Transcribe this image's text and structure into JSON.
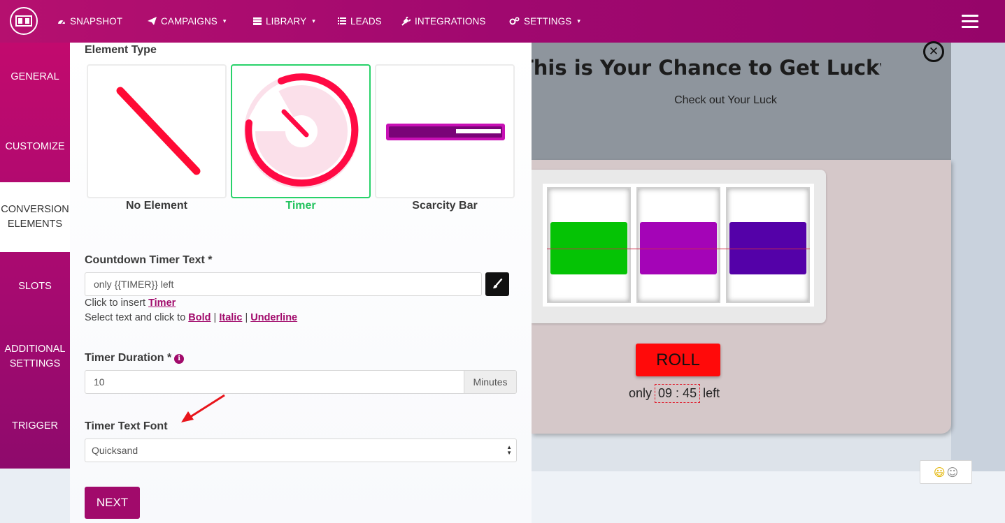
{
  "topnav": {
    "items": [
      {
        "icon": "dashboard-icon",
        "label": "SNAPSHOT",
        "caret": false
      },
      {
        "icon": "paper-plane-icon",
        "label": "CAMPAIGNS",
        "caret": true
      },
      {
        "icon": "library-icon",
        "label": "LIBRARY",
        "caret": true
      },
      {
        "icon": "list-icon",
        "label": "LEADS",
        "caret": false
      },
      {
        "icon": "plug-icon",
        "label": "INTEGRATIONS",
        "caret": false
      },
      {
        "icon": "gears-icon",
        "label": "SETTINGS",
        "caret": true
      }
    ],
    "caret": "▾"
  },
  "sidebar": {
    "items": [
      {
        "label": "GENERAL"
      },
      {
        "label": "CUSTOMIZE"
      },
      {
        "label": "CONVERSION ELEMENTS",
        "active": true
      },
      {
        "label": "SLOTS"
      },
      {
        "label": "ADDITIONAL SETTINGS"
      },
      {
        "label": "TRIGGER"
      }
    ]
  },
  "editor": {
    "element_type_label": "Element Type",
    "cards": [
      {
        "label": "No Element",
        "selected": false
      },
      {
        "label": "Timer",
        "selected": true
      },
      {
        "label": "Scarcity Bar",
        "selected": false
      }
    ],
    "countdown_label": "Countdown Timer Text *",
    "countdown_value": "only {{TIMER}} left",
    "insert_hint_prefix": "Click to insert ",
    "insert_hint_link": "Timer",
    "format_hint_prefix": "Select text and click to ",
    "format_bold": "Bold",
    "format_italic": "Italic",
    "format_underline": "Underline",
    "separator": "|",
    "duration_label": "Timer Duration *",
    "duration_value": "10",
    "duration_unit": "Minutes",
    "font_label": "Timer Text Font",
    "font_value": "Quicksand",
    "next_label": "NEXT"
  },
  "preview": {
    "headline": "This is Your Chance to Get Lucky!",
    "subline": "Check out Your Luck",
    "roll_label": "ROLL",
    "timer_prefix": "only",
    "timer_value": "09 : 45",
    "timer_suffix": "left",
    "reel_colors": [
      "#05c305",
      "#a404b7",
      "#5401a8"
    ]
  },
  "colors": {
    "brand": "#a10a6b",
    "selected_border": "#28d26a",
    "roll_button": "#ff0a0a"
  }
}
